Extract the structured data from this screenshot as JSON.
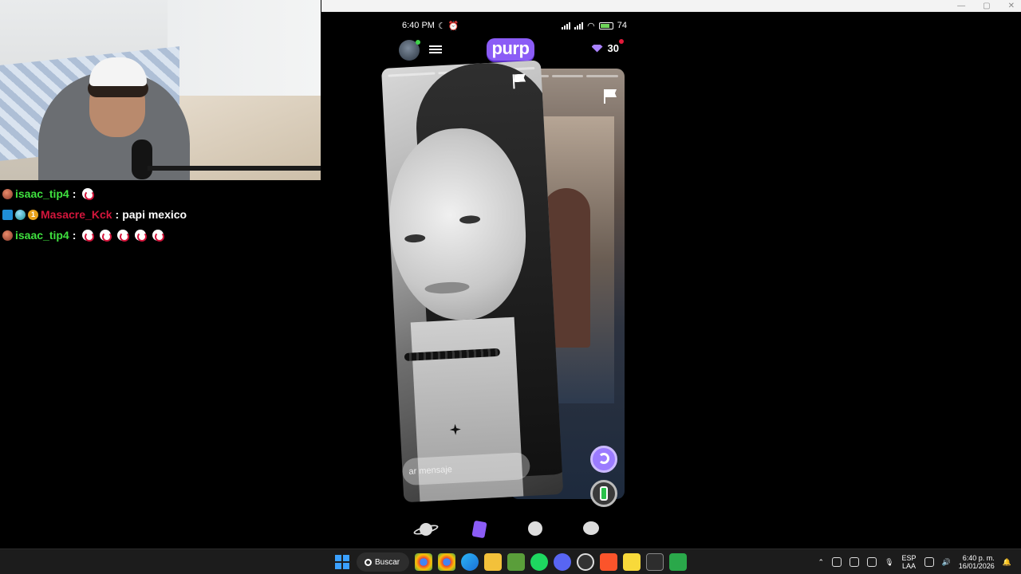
{
  "chat": {
    "messages": [
      {
        "user": "isaac_tip4",
        "user_color": "#3fe03f",
        "badges": [
          "egg"
        ],
        "text": "",
        "emotes": 1
      },
      {
        "user": "Masacre_Kck",
        "user_color": "#d4163c",
        "badges": [
          "arrow",
          "globe",
          "one"
        ],
        "text": "papi mexico",
        "emotes": 0
      },
      {
        "user": "isaac_tip4",
        "user_color": "#3fe03f",
        "badges": [
          "egg"
        ],
        "text": "",
        "emotes": 5
      }
    ]
  },
  "phone": {
    "status": {
      "time": "6:40 PM",
      "battery": "74"
    },
    "app": {
      "logo": "purp",
      "gems": "30",
      "accent": "#8b5cf6"
    },
    "card": {
      "message_placeholder": "ar mensaje"
    },
    "nav": [
      "planet-icon",
      "cards-icon",
      "smiley-icon",
      "chat-bubble-icon"
    ]
  },
  "taskbar": {
    "search_label": "Buscar",
    "lang_top": "ESP",
    "lang_bottom": "LAA",
    "time": "6:40 p. m.",
    "date": "16/01/2026"
  }
}
